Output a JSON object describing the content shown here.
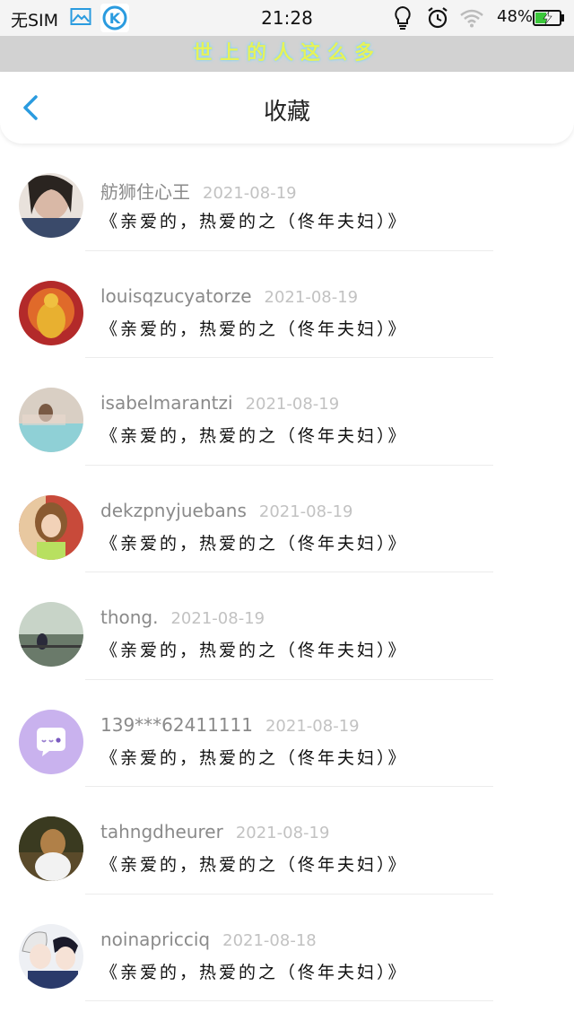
{
  "status_bar": {
    "carrier": "无SIM",
    "time": "21:28",
    "battery_percent": "48%",
    "battery_level": 0.48,
    "icons": [
      "gallery-icon",
      "k-app-icon",
      "bulb-icon",
      "alarm-icon",
      "wifi-icon",
      "battery-charging-icon"
    ]
  },
  "banner": {
    "text": "世上的人这么多"
  },
  "header": {
    "title": "收藏",
    "back_icon": "chevron-left-icon"
  },
  "colors": {
    "accent": "#2a9bdf",
    "username": "#8a8a8a",
    "date": "#c2c2c2",
    "banner_bg": "#d2d2d2"
  },
  "items": [
    {
      "username": "舫狮住心王",
      "date": "2021-08-19",
      "title": "《亲爱的，热爱的之（佟年夫妇）》",
      "avatar": "photo"
    },
    {
      "username": "louisqzucyatorze",
      "date": "2021-08-19",
      "title": "《亲爱的，热爱的之（佟年夫妇）》",
      "avatar": "photo"
    },
    {
      "username": "isabelmarantzi",
      "date": "2021-08-19",
      "title": "《亲爱的，热爱的之（佟年夫妇）》",
      "avatar": "photo"
    },
    {
      "username": "dekzpnyjuebans",
      "date": "2021-08-19",
      "title": "《亲爱的，热爱的之（佟年夫妇）》",
      "avatar": "photo"
    },
    {
      "username": "thong.",
      "date": "2021-08-19",
      "title": "《亲爱的，热爱的之（佟年夫妇）》",
      "avatar": "photo"
    },
    {
      "username": "139***62411111",
      "date": "2021-08-19",
      "title": "《亲爱的，热爱的之（佟年夫妇）》",
      "avatar": "chat-bubble-default"
    },
    {
      "username": "tahngdheurer",
      "date": "2021-08-19",
      "title": "《亲爱的，热爱的之（佟年夫妇）》",
      "avatar": "photo"
    },
    {
      "username": "noinapricciq",
      "date": "2021-08-18",
      "title": "《亲爱的，热爱的之（佟年夫妇）》",
      "avatar": "photo"
    }
  ]
}
